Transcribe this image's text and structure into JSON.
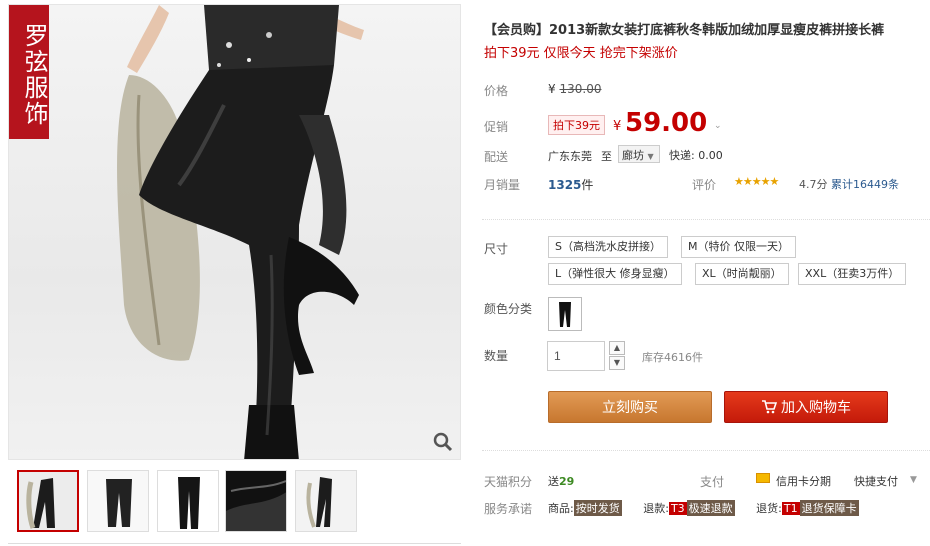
{
  "brand": {
    "seal_text": "罗弦服饰"
  },
  "gallery": {
    "thumbnails": [
      "thumb-1",
      "thumb-2",
      "thumb-3",
      "thumb-4",
      "thumb-5"
    ]
  },
  "product": {
    "title": "【会员购】2013新款女装打底裤秋冬韩版加绒加厚显瘦皮裤拼接长裤",
    "subtitle": "拍下39元 仅限今天 抢完下架涨价"
  },
  "price": {
    "label": "价格",
    "yen": "¥",
    "original": "130.00",
    "promo_label": "促销",
    "promo_tag": "拍下39元",
    "current": "59.00"
  },
  "shipping": {
    "label": "配送",
    "from": "广东东莞",
    "to_word": "至",
    "destination": "廊坊",
    "express": "快递: 0.00"
  },
  "sales": {
    "label": "月销量",
    "count": "1325",
    "unit": "件",
    "rating_label": "评价",
    "stars": "★★★★★",
    "score": "4.7分",
    "review_total": "累计16449条"
  },
  "size": {
    "label": "尺寸",
    "options": [
      "S（高档洗水皮拼接）",
      "M（特价 仅限一天）",
      "L（弹性很大 修身显瘦）",
      "XL（时尚靓丽）",
      "XXL（狂卖3万件）"
    ]
  },
  "color": {
    "label": "颜色分类"
  },
  "quantity": {
    "label": "数量",
    "value": "1",
    "stock": "库存4616件"
  },
  "actions": {
    "buy": "立刻购买",
    "cart": "加入购物车"
  },
  "extras": {
    "points_label": "天猫积分",
    "points_prefix": "送",
    "points_value": "29",
    "pay_label": "支付",
    "credit": "信用卡分期",
    "quick_pay": "快捷支付",
    "promise_label": "服务承诺",
    "goods": "商品:",
    "goods_badge": "按时发货",
    "refund": "退款:",
    "refund_tag": "T3",
    "refund_badge": "极速退款",
    "return": "退货:",
    "return_tag": "T1",
    "return_badge": "退货保障卡"
  },
  "colors": {
    "accent": "#c40000",
    "buy_button": "#c7772f",
    "cart_button": "#c41a0a",
    "seal": "#b5141d"
  }
}
